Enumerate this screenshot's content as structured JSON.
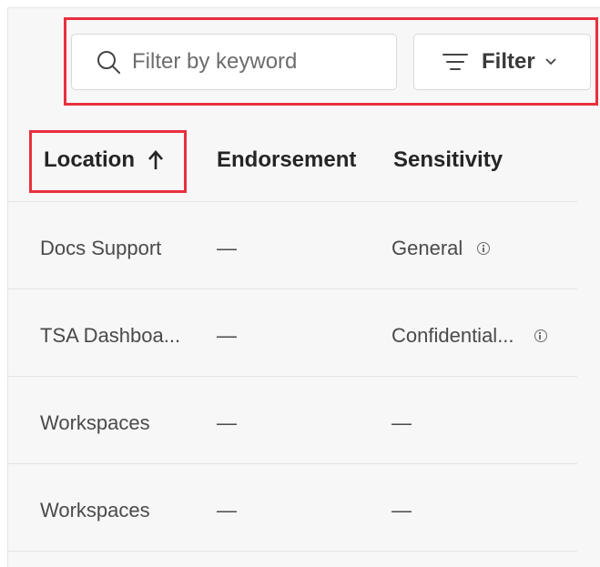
{
  "toolbar": {
    "search": {
      "placeholder": "Filter by keyword",
      "value": ""
    },
    "filter_label": "Filter"
  },
  "columns": {
    "location": "Location",
    "endorsement": "Endorsement",
    "sensitivity": "Sensitivity"
  },
  "sort": {
    "column": "location",
    "direction": "ascending"
  },
  "rows": [
    {
      "location": "Docs Support",
      "endorsement": "—",
      "sensitivity": "General",
      "sensitivity_info": true
    },
    {
      "location": "TSA Dashboa...",
      "endorsement": "—",
      "sensitivity": "Confidential...",
      "sensitivity_info": true
    },
    {
      "location": "Workspaces",
      "endorsement": "—",
      "sensitivity": "—",
      "sensitivity_info": false
    },
    {
      "location": "Workspaces",
      "endorsement": "—",
      "sensitivity": "—",
      "sensitivity_info": false
    }
  ],
  "highlight_color": "#e8303d"
}
